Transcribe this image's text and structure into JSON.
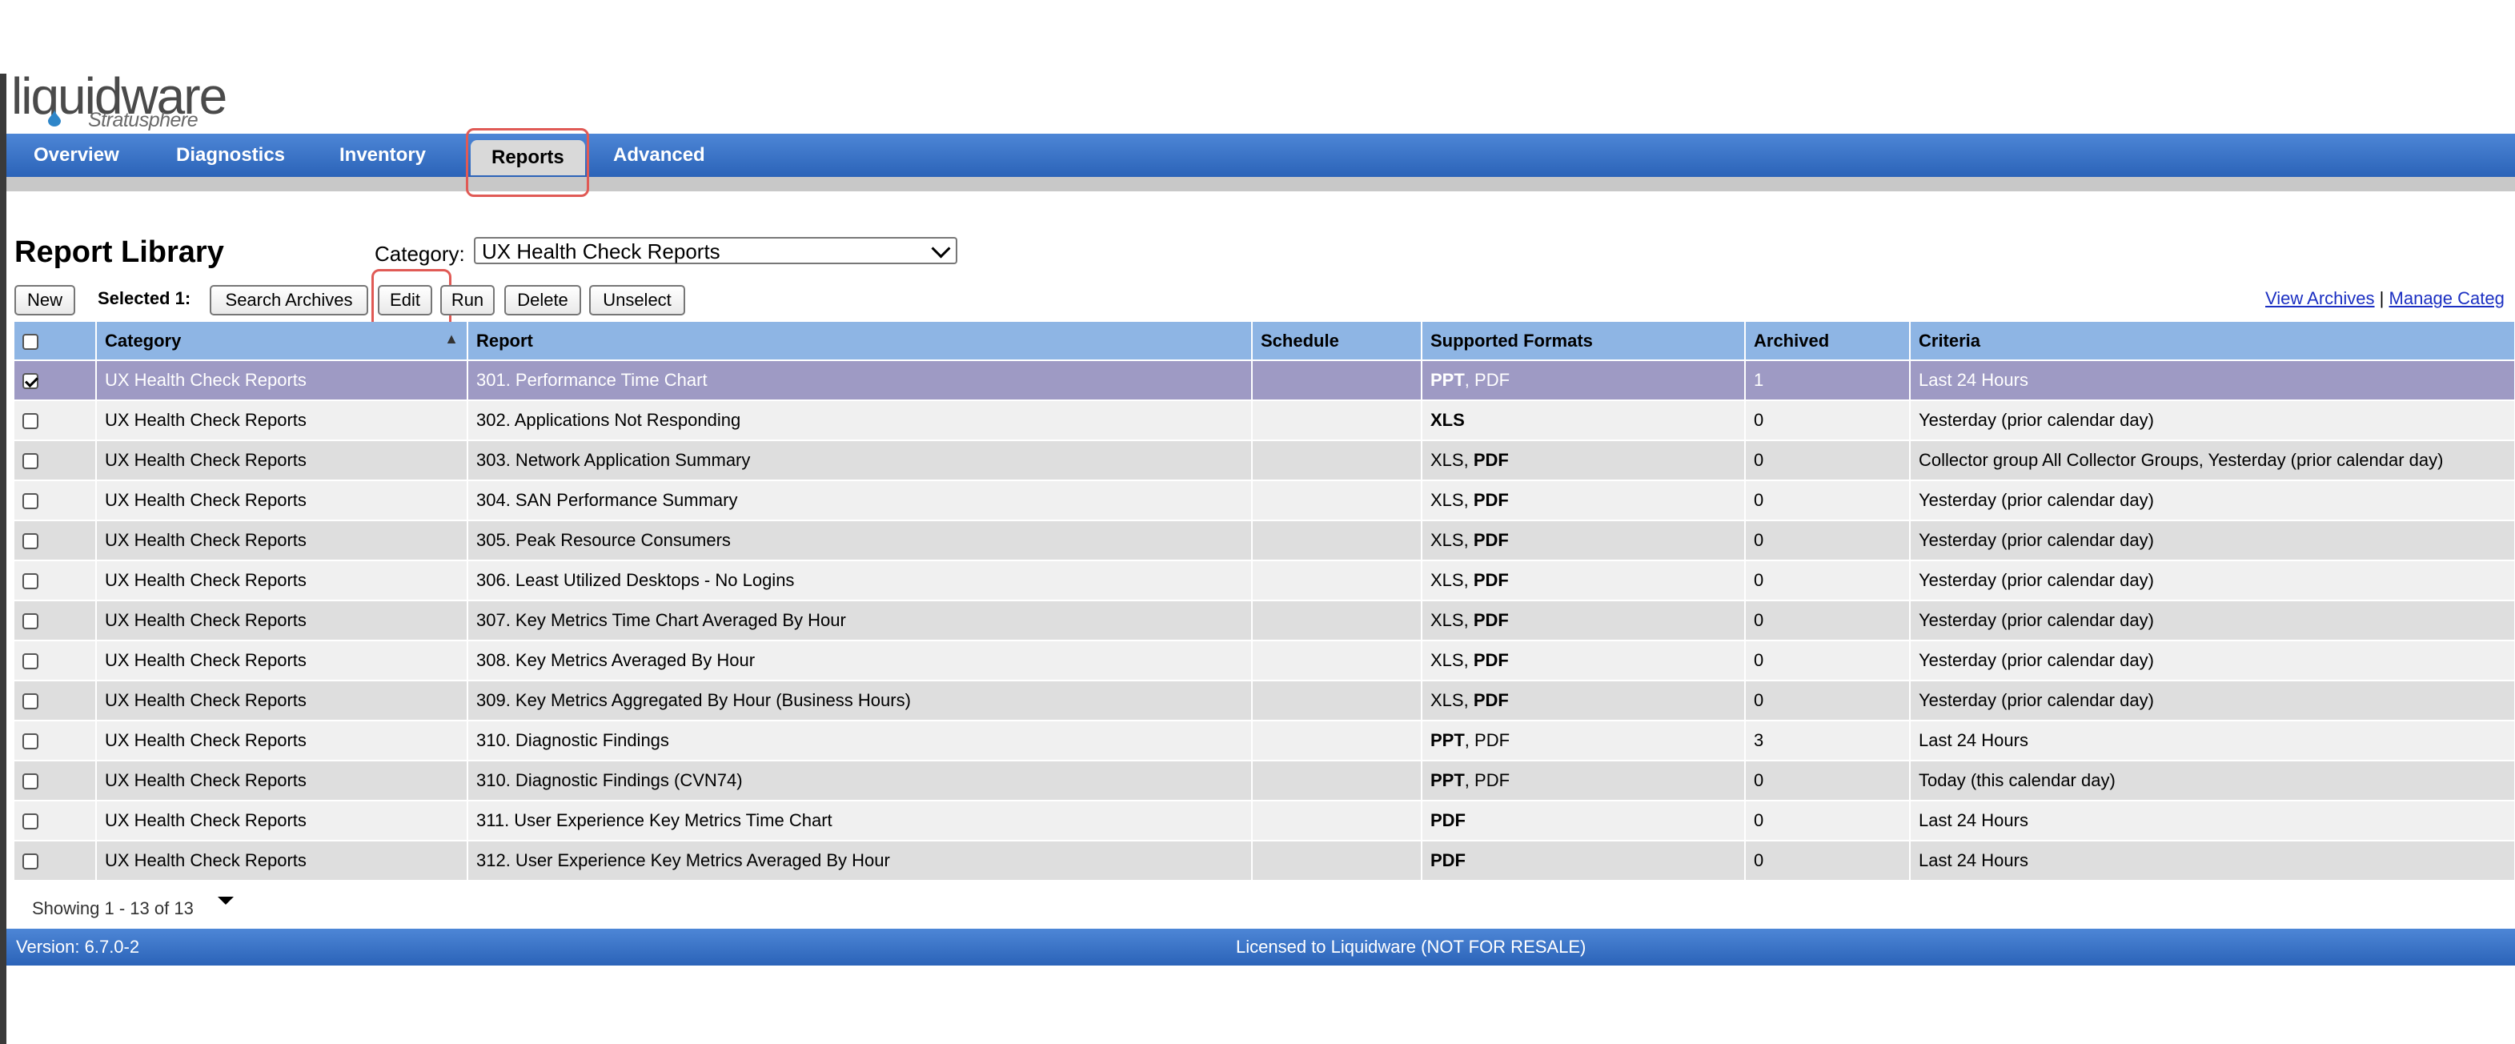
{
  "logo": {
    "wordmark": "liquidware",
    "product": "Stratusphere"
  },
  "nav": {
    "tabs": [
      {
        "label": "Overview"
      },
      {
        "label": "Diagnostics"
      },
      {
        "label": "Inventory"
      },
      {
        "label": "Reports",
        "active": true
      },
      {
        "label": "Advanced"
      }
    ]
  },
  "page": {
    "title": "Report Library",
    "category_label": "Category:",
    "category_value": "UX Health Check Reports"
  },
  "toolbar": {
    "new": "New",
    "selected_label": "Selected 1:",
    "search_archives": "Search Archives",
    "edit": "Edit",
    "run": "Run",
    "delete": "Delete",
    "unselect": "Unselect",
    "view_archives": "View Archives",
    "separator": "|",
    "manage_categories": "Manage Categ"
  },
  "table": {
    "headers": [
      "Category",
      "Report",
      "Schedule",
      "Supported Formats",
      "Archived",
      "Criteria"
    ],
    "rows": [
      {
        "checked": true,
        "category": "UX Health Check Reports",
        "report": "301. Performance Time Chart",
        "schedule": "",
        "fmt_a": "PPT",
        "fmt_a_bold": true,
        "fmt_sep": ", ",
        "fmt_b": "PDF",
        "fmt_b_bold": false,
        "archived": "1",
        "criteria": "Last 24 Hours"
      },
      {
        "checked": false,
        "category": "UX Health Check Reports",
        "report": "302. Applications Not Responding",
        "schedule": "",
        "fmt_a": "XLS",
        "fmt_a_bold": true,
        "fmt_sep": "",
        "fmt_b": "",
        "fmt_b_bold": false,
        "archived": "0",
        "criteria": "Yesterday (prior calendar day)"
      },
      {
        "checked": false,
        "category": "UX Health Check Reports",
        "report": "303. Network Application Summary",
        "schedule": "",
        "fmt_a": "XLS",
        "fmt_a_bold": false,
        "fmt_sep": ", ",
        "fmt_b": "PDF",
        "fmt_b_bold": true,
        "archived": "0",
        "criteria": "Collector group All Collector Groups, Yesterday (prior calendar day)"
      },
      {
        "checked": false,
        "category": "UX Health Check Reports",
        "report": "304. SAN Performance Summary",
        "schedule": "",
        "fmt_a": "XLS",
        "fmt_a_bold": false,
        "fmt_sep": ", ",
        "fmt_b": "PDF",
        "fmt_b_bold": true,
        "archived": "0",
        "criteria": "Yesterday (prior calendar day)"
      },
      {
        "checked": false,
        "category": "UX Health Check Reports",
        "report": "305. Peak Resource Consumers",
        "schedule": "",
        "fmt_a": "XLS",
        "fmt_a_bold": false,
        "fmt_sep": ", ",
        "fmt_b": "PDF",
        "fmt_b_bold": true,
        "archived": "0",
        "criteria": "Yesterday (prior calendar day)"
      },
      {
        "checked": false,
        "category": "UX Health Check Reports",
        "report": "306. Least Utilized Desktops - No Logins",
        "schedule": "",
        "fmt_a": "XLS",
        "fmt_a_bold": false,
        "fmt_sep": ", ",
        "fmt_b": "PDF",
        "fmt_b_bold": true,
        "archived": "0",
        "criteria": "Yesterday (prior calendar day)"
      },
      {
        "checked": false,
        "category": "UX Health Check Reports",
        "report": "307. Key Metrics Time Chart Averaged By Hour",
        "schedule": "",
        "fmt_a": "XLS",
        "fmt_a_bold": false,
        "fmt_sep": ", ",
        "fmt_b": "PDF",
        "fmt_b_bold": true,
        "archived": "0",
        "criteria": "Yesterday (prior calendar day)"
      },
      {
        "checked": false,
        "category": "UX Health Check Reports",
        "report": "308. Key Metrics Averaged By Hour",
        "schedule": "",
        "fmt_a": "XLS",
        "fmt_a_bold": false,
        "fmt_sep": ", ",
        "fmt_b": "PDF",
        "fmt_b_bold": true,
        "archived": "0",
        "criteria": "Yesterday (prior calendar day)"
      },
      {
        "checked": false,
        "category": "UX Health Check Reports",
        "report": "309. Key Metrics Aggregated By Hour (Business Hours)",
        "schedule": "",
        "fmt_a": "XLS",
        "fmt_a_bold": false,
        "fmt_sep": ", ",
        "fmt_b": "PDF",
        "fmt_b_bold": true,
        "archived": "0",
        "criteria": "Yesterday (prior calendar day)"
      },
      {
        "checked": false,
        "category": "UX Health Check Reports",
        "report": "310. Diagnostic Findings",
        "schedule": "",
        "fmt_a": "PPT",
        "fmt_a_bold": true,
        "fmt_sep": ", ",
        "fmt_b": "PDF",
        "fmt_b_bold": false,
        "archived": "3",
        "criteria": "Last 24 Hours"
      },
      {
        "checked": false,
        "category": "UX Health Check Reports",
        "report": "310. Diagnostic Findings (CVN74)",
        "schedule": "",
        "fmt_a": "PPT",
        "fmt_a_bold": true,
        "fmt_sep": ", ",
        "fmt_b": "PDF",
        "fmt_b_bold": false,
        "archived": "0",
        "criteria": "Today (this calendar day)"
      },
      {
        "checked": false,
        "category": "UX Health Check Reports",
        "report": "311. User Experience Key Metrics Time Chart",
        "schedule": "",
        "fmt_a": "PDF",
        "fmt_a_bold": true,
        "fmt_sep": "",
        "fmt_b": "",
        "fmt_b_bold": false,
        "archived": "0",
        "criteria": "Last 24 Hours"
      },
      {
        "checked": false,
        "category": "UX Health Check Reports",
        "report": "312. User Experience Key Metrics Averaged By Hour",
        "schedule": "",
        "fmt_a": "PDF",
        "fmt_a_bold": true,
        "fmt_sep": "",
        "fmt_b": "",
        "fmt_b_bold": false,
        "archived": "0",
        "criteria": "Last 24 Hours"
      }
    ]
  },
  "pagination": {
    "showing": "Showing 1 - 13 of 13"
  },
  "footer": {
    "version": "Version: 6.7.0-2",
    "license": "Licensed to Liquidware (NOT FOR RESALE)"
  },
  "colors": {
    "nav_blue": "#2b63b8",
    "header_blue": "#8eb5e4",
    "selected_row": "#9e9ac4",
    "highlight": "#e05a55",
    "link": "#1b2fc2"
  }
}
